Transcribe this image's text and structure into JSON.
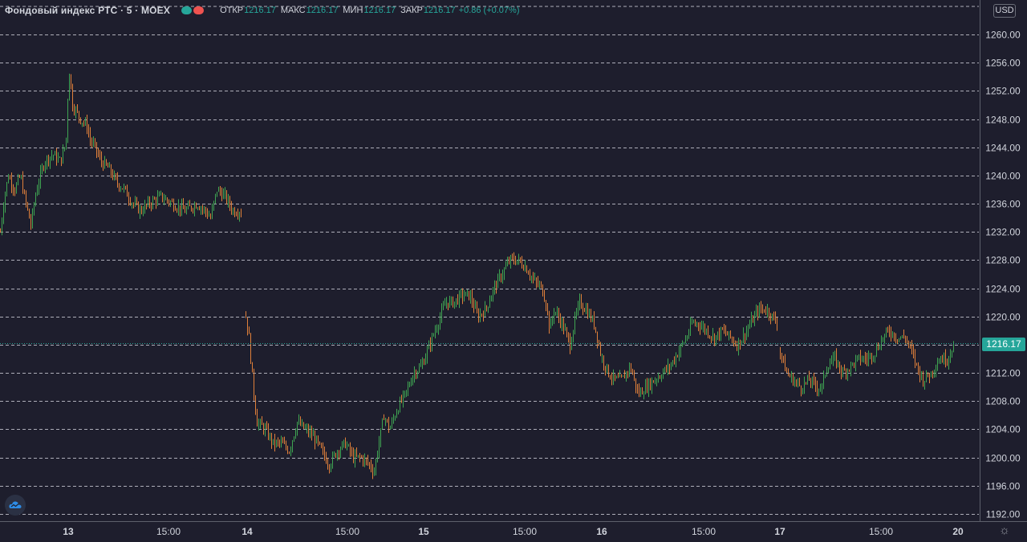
{
  "header": {
    "symbol": "Фондовый индекс РТС",
    "interval": "5",
    "exchange": "MOEX",
    "open_label": "ОТКР",
    "open_value": "1216.17",
    "high_label": "МАКС",
    "high_value": "1216.17",
    "low_label": "МИН",
    "low_value": "1216.17",
    "close_label": "ЗАКР",
    "close_value": "1216.17",
    "change": "+0.86 (+0.07%)"
  },
  "currency_button": "USD",
  "price_axis_top": "1",
  "last_price_tag": "1216.17",
  "colors": {
    "background": "#1e1e2d",
    "up": "#26a69a",
    "down": "#ef5350",
    "candle_up": "#3fa552",
    "candle_down": "#e0803a",
    "grid": "#c8c8d2",
    "last_line": "#26a69a"
  },
  "icons": {
    "logo": "tradingview-logo-icon",
    "settings": "gear-icon"
  },
  "chart_data": {
    "type": "ohlc",
    "title": "Фондовый индекс РТС",
    "y_ticks": [
      "1260.00",
      "1256.00",
      "1252.00",
      "1248.00",
      "1244.00",
      "1240.00",
      "1236.00",
      "1232.00",
      "1228.00",
      "1224.00",
      "1220.00",
      "1216.00",
      "1212.00",
      "1208.00",
      "1204.00",
      "1200.00",
      "1196.00",
      "1192.00"
    ],
    "x_ticks": [
      "13",
      "15:00",
      "14",
      "15:00",
      "15",
      "15:00",
      "16",
      "15:00",
      "17",
      "15:00",
      "20"
    ],
    "ylim": [
      1191,
      1264
    ],
    "grid": true,
    "last_price": 1216.17,
    "sessions": [
      {
        "day": "13",
        "points": [
          [
            0,
            1232
          ],
          [
            5,
            1237
          ],
          [
            10,
            1240
          ],
          [
            18,
            1238
          ],
          [
            25,
            1240
          ],
          [
            30,
            1237
          ],
          [
            38,
            1233
          ],
          [
            45,
            1238
          ],
          [
            55,
            1242
          ],
          [
            65,
            1243
          ],
          [
            75,
            1242
          ],
          [
            80,
            1244
          ],
          [
            83,
            1246
          ],
          [
            85,
            1256
          ],
          [
            90,
            1250
          ],
          [
            95,
            1249
          ],
          [
            100,
            1248
          ],
          [
            108,
            1247
          ],
          [
            112,
            1245
          ],
          [
            118,
            1244
          ],
          [
            125,
            1242
          ],
          [
            135,
            1241
          ],
          [
            145,
            1239
          ],
          [
            155,
            1238
          ],
          [
            165,
            1236
          ],
          [
            175,
            1235
          ],
          [
            185,
            1236
          ],
          [
            200,
            1237
          ],
          [
            215,
            1236
          ],
          [
            230,
            1235
          ],
          [
            245,
            1236
          ],
          [
            255,
            1235
          ],
          [
            262,
            1234
          ],
          [
            270,
            1238
          ],
          [
            280,
            1237
          ],
          [
            290,
            1235
          ],
          [
            300,
            1235
          ]
        ]
      },
      {
        "day": "14",
        "points": [
          [
            306,
            1220
          ],
          [
            310,
            1217
          ],
          [
            315,
            1210
          ],
          [
            320,
            1205
          ],
          [
            330,
            1204
          ],
          [
            340,
            1202
          ],
          [
            350,
            1202
          ],
          [
            360,
            1201
          ],
          [
            370,
            1205
          ],
          [
            380,
            1204
          ],
          [
            390,
            1203
          ],
          [
            400,
            1201
          ],
          [
            410,
            1199
          ],
          [
            420,
            1201
          ],
          [
            430,
            1202
          ],
          [
            440,
            1200
          ],
          [
            450,
            1200
          ],
          [
            460,
            1199
          ],
          [
            466,
            1198
          ],
          [
            470,
            1201
          ],
          [
            478,
            1206
          ],
          [
            485,
            1204
          ],
          [
            495,
            1207
          ],
          [
            505,
            1209
          ],
          [
            515,
            1212
          ],
          [
            525,
            1213
          ],
          [
            535,
            1216
          ],
          [
            545,
            1219
          ],
          [
            555,
            1222
          ],
          [
            565,
            1222
          ],
          [
            575,
            1223
          ],
          [
            585,
            1223
          ],
          [
            595,
            1220
          ],
          [
            605,
            1221
          ],
          [
            615,
            1224
          ],
          [
            625,
            1226
          ],
          [
            635,
            1228
          ],
          [
            645,
            1228
          ],
          [
            655,
            1227
          ],
          [
            665,
            1225
          ],
          [
            675,
            1224
          ],
          [
            680,
            1222
          ],
          [
            685,
            1218
          ],
          [
            690,
            1221
          ],
          [
            700,
            1219
          ],
          [
            710,
            1216
          ],
          [
            715,
            1219
          ],
          [
            722,
            1222
          ],
          [
            730,
            1221
          ],
          [
            740,
            1219
          ],
          [
            748,
            1215
          ]
        ]
      },
      {
        "day": "16",
        "points": [
          [
            750,
            1214
          ],
          [
            758,
            1212
          ],
          [
            765,
            1211
          ],
          [
            775,
            1211
          ],
          [
            785,
            1213
          ],
          [
            795,
            1209
          ],
          [
            805,
            1210
          ],
          [
            815,
            1211
          ],
          [
            825,
            1212
          ],
          [
            835,
            1213
          ],
          [
            845,
            1215
          ],
          [
            855,
            1217
          ],
          [
            862,
            1219
          ],
          [
            870,
            1219
          ],
          [
            880,
            1218
          ],
          [
            890,
            1217
          ],
          [
            900,
            1218
          ],
          [
            910,
            1217
          ],
          [
            918,
            1216
          ],
          [
            925,
            1217
          ],
          [
            935,
            1219
          ],
          [
            945,
            1221
          ],
          [
            955,
            1221
          ],
          [
            962,
            1220
          ],
          [
            968,
            1219
          ]
        ]
      },
      {
        "day": "17",
        "points": [
          [
            972,
            1215
          ],
          [
            980,
            1212
          ],
          [
            988,
            1211
          ],
          [
            998,
            1210
          ],
          [
            1008,
            1211
          ],
          [
            1018,
            1210
          ],
          [
            1024,
            1210
          ],
          [
            1030,
            1213
          ],
          [
            1040,
            1214
          ],
          [
            1050,
            1212
          ],
          [
            1060,
            1213
          ],
          [
            1070,
            1214
          ],
          [
            1080,
            1214
          ],
          [
            1090,
            1215
          ],
          [
            1100,
            1217
          ],
          [
            1108,
            1218
          ],
          [
            1118,
            1217
          ],
          [
            1128,
            1217
          ],
          [
            1136,
            1215
          ],
          [
            1142,
            1213
          ],
          [
            1150,
            1211
          ],
          [
            1160,
            1212
          ],
          [
            1170,
            1214
          ],
          [
            1180,
            1214
          ],
          [
            1188,
            1216
          ]
        ]
      }
    ]
  }
}
